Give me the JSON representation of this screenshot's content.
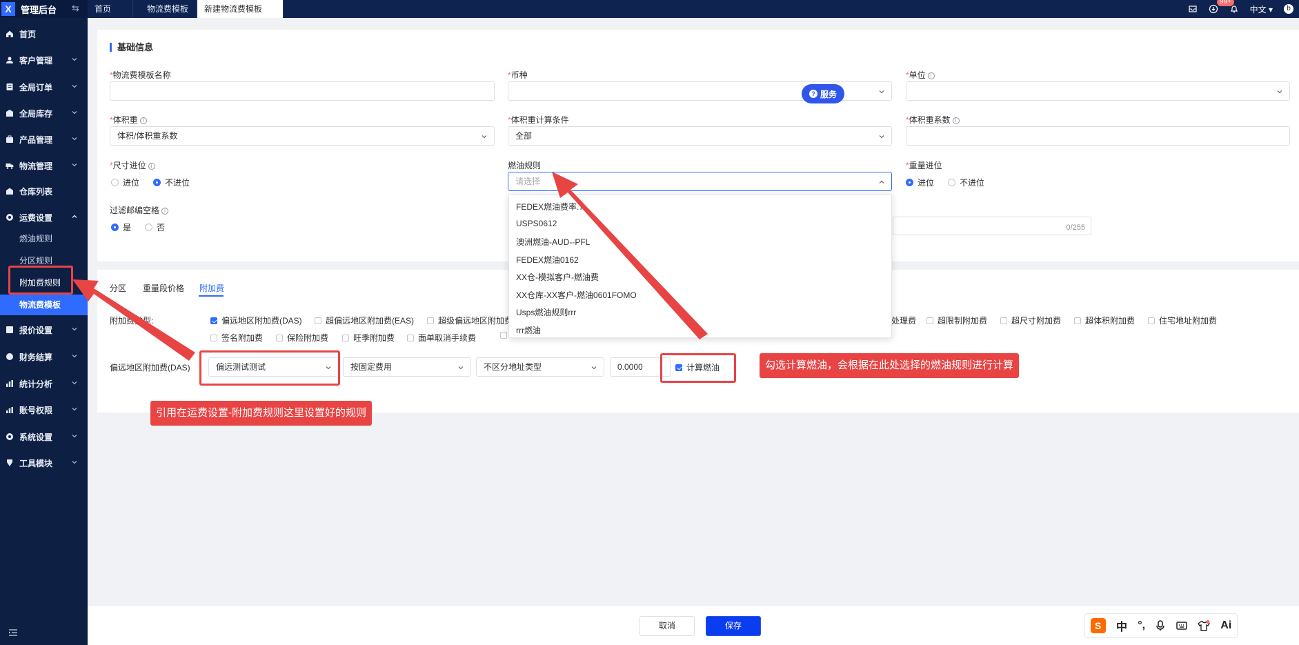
{
  "header": {
    "app_title": "管理后台",
    "tabs": [
      "首页",
      "物流费模板",
      "新建物流费模板"
    ],
    "notification_count": "99+",
    "language": "中文",
    "user_initial": "b"
  },
  "sidebar": {
    "items": [
      {
        "label": "首页",
        "icon": "home-icon"
      },
      {
        "label": "客户管理",
        "icon": "user-icon"
      },
      {
        "label": "全局订单",
        "icon": "order-icon"
      },
      {
        "label": "全局库存",
        "icon": "stock-icon"
      },
      {
        "label": "产品管理",
        "icon": "product-icon"
      },
      {
        "label": "物流管理",
        "icon": "truck-icon"
      },
      {
        "label": "仓库列表",
        "icon": "warehouse-icon"
      },
      {
        "label": "运费设置",
        "icon": "freight-icon"
      },
      {
        "label": "报价设置",
        "icon": "quote-icon"
      },
      {
        "label": "财务结算",
        "icon": "finance-icon"
      },
      {
        "label": "统计分析",
        "icon": "stats-icon"
      },
      {
        "label": "账号权限",
        "icon": "account-icon"
      },
      {
        "label": "系统设置",
        "icon": "settings-icon"
      },
      {
        "label": "工具模块",
        "icon": "tool-icon"
      }
    ],
    "sub_items": [
      "燃油规则",
      "分区规则",
      "附加费规则",
      "物流费模板"
    ]
  },
  "basic_info": {
    "section_title": "基础信息",
    "name_label": "物流费模板名称",
    "currency_label": "币种",
    "unit_label": "单位",
    "volume_weight_label": "体积重",
    "volume_weight_value": "体积/体积重系数",
    "volume_condition_label": "体积重计算条件",
    "volume_condition_value": "全部",
    "volume_factor_label": "体积重系数",
    "size_round_label": "尺寸进位",
    "fuel_rule_label": "燃油规则",
    "fuel_rule_placeholder": "请选择",
    "weight_round_label": "重量进位",
    "filter_label": "过滤邮编空格",
    "opt_round": "进位",
    "opt_no_round": "不进位",
    "opt_yes": "是",
    "opt_no": "否",
    "service_button": "服务",
    "textarea_counter": "0/255"
  },
  "fuel_dropdown": {
    "options": [
      "FEDEX燃油费率.7",
      "USPS0612",
      "澳洲燃油-AUD--PFL",
      "FEDEX燃油0162",
      "XX仓-模拟客户-燃油费",
      "XX仓库-XX客户-燃油0601FOMO",
      "Usps燃油规则rrr",
      "rrr燃油"
    ]
  },
  "surcharge": {
    "tabs": [
      "分区",
      "重量段价格",
      "附加费"
    ],
    "type_label": "附加费类型:",
    "types_row1": [
      "偏远地区附加费(DAS)",
      "超偏远地区附加费(EAS)",
      "超级偏远地区附加费"
    ],
    "types_row1_right": [
      "处理费",
      "超限制附加费",
      "超尺寸附加费",
      "超体积附加费",
      "住宅地址附加费"
    ],
    "types_row2": [
      "签名附加费",
      "保险附加费",
      "旺季附加费",
      "面单取消手续费"
    ],
    "das_label": "偏远地区附加费(DAS)",
    "das_rule": "偏远测试测试",
    "fee_mode": "按固定费用",
    "address_type": "不区分地址类型",
    "amount": "0.0000",
    "calc_fuel_label": "计算燃油"
  },
  "annotations": {
    "left_callout": "引用在运费设置-附加费规则这里设置好的规则",
    "right_callout": "勾选计算燃油，会根据在此处选择的燃油规则进行计算"
  },
  "footer": {
    "cancel": "取消",
    "save": "保存"
  },
  "ime": {
    "items": [
      "S",
      "中",
      "°,",
      "mic-icon",
      "keyboard-icon",
      "shirt-icon",
      "Ai"
    ]
  }
}
